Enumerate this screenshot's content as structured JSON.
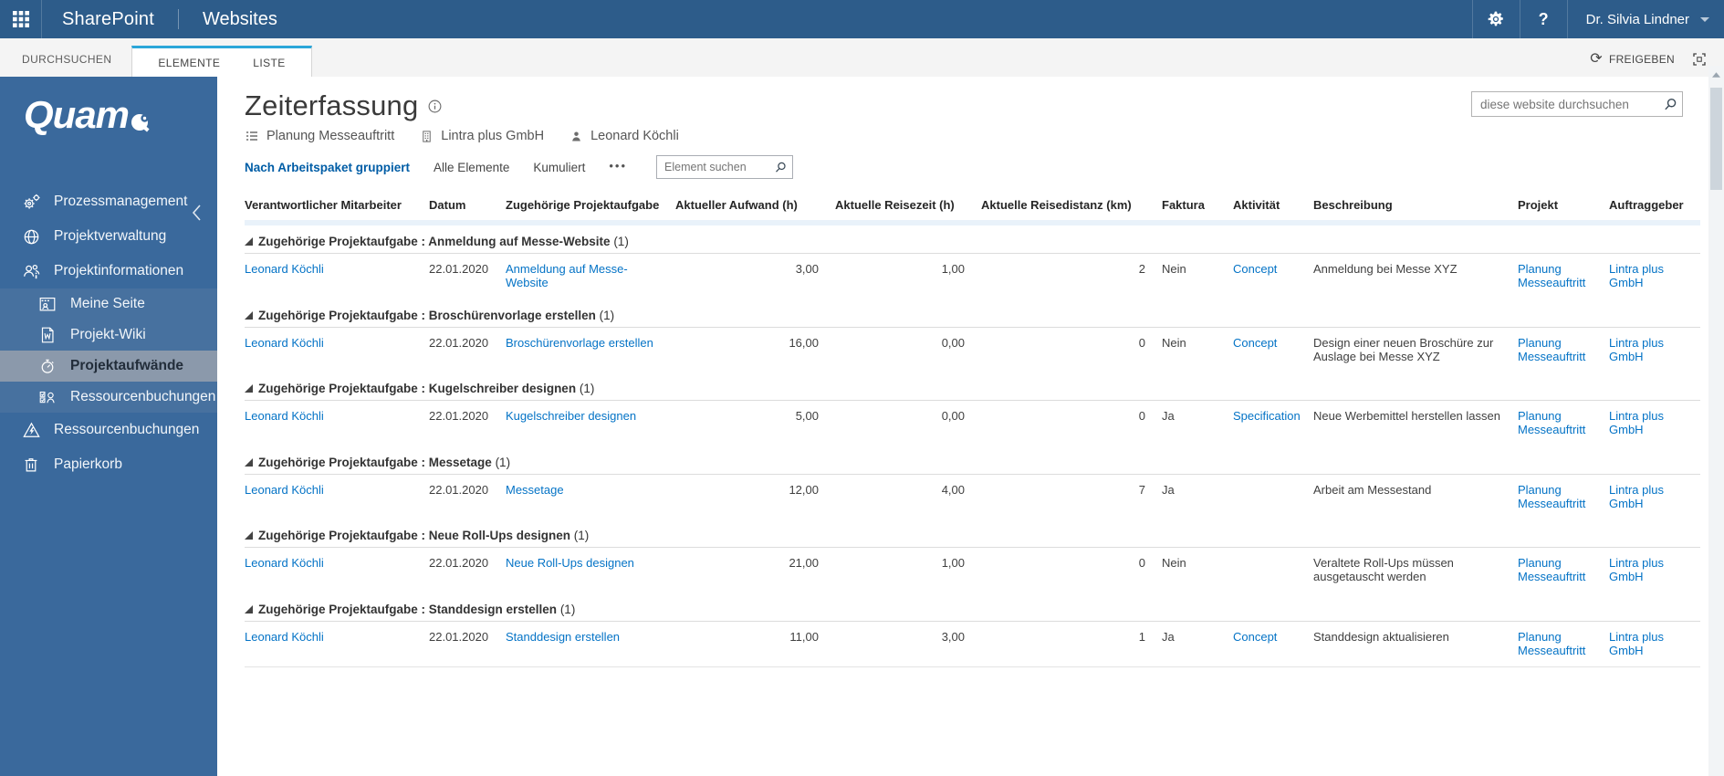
{
  "suite_bar": {
    "brand": "SharePoint",
    "section": "Websites",
    "help_glyph": "?",
    "user_name": "Dr. Silvia Lindner"
  },
  "ribbon": {
    "browse_tab": "DURCHSUCHEN",
    "tabs": [
      "ELEMENTE",
      "LISTE"
    ],
    "share_label": "FREIGEBEN"
  },
  "sidebar": {
    "logo_text": "Quam",
    "items": [
      {
        "label": "Prozessmanagement",
        "icon": "gears-icon"
      },
      {
        "label": "Projektverwaltung",
        "icon": "globe-icon"
      },
      {
        "label": "Projektinformationen",
        "icon": "team-info-icon"
      },
      {
        "label": "Meine Seite",
        "icon": "my-site-icon"
      },
      {
        "label": "Projekt-Wiki",
        "icon": "wiki-document-icon"
      },
      {
        "label": "Projektaufwände",
        "icon": "stopwatch-icon",
        "selected": true
      },
      {
        "label": "Ressourcenbuchungen",
        "icon": "booking-checklist-icon"
      },
      {
        "label": "Ressourcenbuchungen",
        "icon": "warning-bolt-icon"
      },
      {
        "label": "Papierkorb",
        "icon": "trash-icon"
      }
    ]
  },
  "page": {
    "title": "Zeiterfassung",
    "context_items": [
      {
        "icon": "list-icon",
        "label": "Planung Messeauftritt"
      },
      {
        "icon": "building-icon",
        "label": "Lintra plus GmbH"
      },
      {
        "icon": "person-icon",
        "label": "Leonard Köchli"
      }
    ],
    "views": [
      {
        "label": "Nach Arbeitspaket gruppiert",
        "selected": true
      },
      {
        "label": "Alle Elemente",
        "selected": false
      },
      {
        "label": "Kumuliert",
        "selected": false
      }
    ],
    "ellipsis": "•••",
    "item_search_placeholder": "Element suchen",
    "site_search_placeholder": "diese website durchsuchen"
  },
  "table": {
    "group_prefix": "Zugehörige Projektaufgabe",
    "columns": [
      "Verantwortlicher Mitarbeiter",
      "Datum",
      "Zugehörige Projektaufgabe",
      "Aktueller Aufwand (h)",
      "Aktuelle Reisezeit (h)",
      "Aktuelle Reisedistanz (km)",
      "Faktura",
      "Aktivität",
      "Beschreibung",
      "Projekt",
      "Auftraggeber"
    ],
    "groups": [
      {
        "task": "Anmeldung auf Messe-Website",
        "count": 1,
        "row": {
          "employee": "Leonard Köchli",
          "date": "22.01.2020",
          "task": "Anmeldung auf Messe-Website",
          "effort": "3,00",
          "travel_time": "1,00",
          "travel_distance": "2",
          "billing": "Nein",
          "activity": "Concept",
          "description": "Anmeldung bei Messe XYZ",
          "project": "Planung Messeauftritt",
          "client": "Lintra plus GmbH"
        }
      },
      {
        "task": "Broschürenvorlage erstellen",
        "count": 1,
        "row": {
          "employee": "Leonard Köchli",
          "date": "22.01.2020",
          "task": "Broschürenvorlage erstellen",
          "effort": "16,00",
          "travel_time": "0,00",
          "travel_distance": "0",
          "billing": "Nein",
          "activity": "Concept",
          "description": "Design einer neuen Broschüre zur Auslage bei Messe XYZ",
          "project": "Planung Messeauftritt",
          "client": "Lintra plus GmbH"
        }
      },
      {
        "task": "Kugelschreiber designen",
        "count": 1,
        "row": {
          "employee": "Leonard Köchli",
          "date": "22.01.2020",
          "task": "Kugelschreiber designen",
          "effort": "5,00",
          "travel_time": "0,00",
          "travel_distance": "0",
          "billing": "Ja",
          "activity": "Specification",
          "description": "Neue Werbemittel herstellen lassen",
          "project": "Planung Messeauftritt",
          "client": "Lintra plus GmbH"
        }
      },
      {
        "task": "Messetage",
        "count": 1,
        "row": {
          "employee": "Leonard Köchli",
          "date": "22.01.2020",
          "task": "Messetage",
          "effort": "12,00",
          "travel_time": "4,00",
          "travel_distance": "7",
          "billing": "Ja",
          "activity": "",
          "description": "Arbeit am Messestand",
          "project": "Planung Messeauftritt",
          "client": "Lintra plus GmbH"
        }
      },
      {
        "task": "Neue Roll-Ups designen",
        "count": 1,
        "row": {
          "employee": "Leonard Köchli",
          "date": "22.01.2020",
          "task": "Neue Roll-Ups designen",
          "effort": "21,00",
          "travel_time": "1,00",
          "travel_distance": "0",
          "billing": "Nein",
          "activity": "",
          "description": "Veraltete Roll-Ups müssen ausgetauscht werden",
          "project": "Planung Messeauftritt",
          "client": "Lintra plus GmbH"
        }
      },
      {
        "task": "Standdesign erstellen",
        "count": 1,
        "row": {
          "employee": "Leonard Köchli",
          "date": "22.01.2020",
          "task": "Standdesign erstellen",
          "effort": "11,00",
          "travel_time": "3,00",
          "travel_distance": "1",
          "billing": "Ja",
          "activity": "Concept",
          "description": "Standdesign aktualisieren",
          "project": "Planung Messeauftritt",
          "client": "Lintra plus GmbH"
        }
      }
    ]
  },
  "colors": {
    "suite_bar": "#2d5c8a",
    "sidebar": "#3a699c",
    "sidebar_subsection": "#47719f",
    "sidebar_selected": "#8b99ab",
    "tab_accent": "#2ba6d9",
    "link_blue": "#0473c6"
  }
}
